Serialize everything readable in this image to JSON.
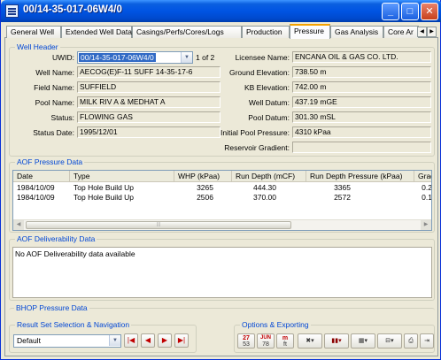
{
  "window": {
    "title": "00/14-35-017-06W4/0"
  },
  "tabs": [
    "General Well",
    "Extended Well Data",
    "Casings/Perfs/Cores/Logs",
    "Production",
    "Pressure",
    "Gas Analysis",
    "Core Ar"
  ],
  "well_header": {
    "legend": "Well Header",
    "uwid_label": "UWID:",
    "uwid_value": "00/14-35-017-06W4/0",
    "uwid_count": "1 of 2",
    "well_name_label": "Well Name:",
    "well_name": "AECOG(E)F-11 SUFF 14-35-17-6",
    "field_name_label": "Field Name:",
    "field_name": "SUFFIELD",
    "pool_name_label": "Pool Name:",
    "pool_name": "MILK RIV A & MEDHAT A",
    "status_label": "Status:",
    "status": "FLOWING GAS",
    "status_date_label": "Status Date:",
    "status_date": "1995/12/01",
    "licensee_label": "Licensee Name:",
    "licensee": "ENCANA OIL & GAS CO. LTD.",
    "ground_elev_label": "Ground Elevation:",
    "ground_elev": "738.50 m",
    "kb_elev_label": "KB Elevation:",
    "kb_elev": "742.00 m",
    "well_datum_label": "Well Datum:",
    "well_datum": "437.19 mGE",
    "pool_datum_label": "Pool Datum:",
    "pool_datum": "301.30 mSL",
    "initial_pressure_label": "Initial Pool Pressure:",
    "initial_pressure": "4310 kPaa",
    "reservoir_gradient_label": "Reservoir Gradient:",
    "reservoir_gradient": ""
  },
  "aof_pressure": {
    "legend": "AOF Pressure Data",
    "columns": [
      "Date",
      "Type",
      "WHP (kPaa)",
      "Run Depth (mCF)",
      "Run Depth Pressure (kPaa)",
      "Grad"
    ],
    "rows": [
      [
        "1984/10/09",
        "Top Hole Build Up",
        "3265",
        "444.30",
        "3365",
        "0.2"
      ],
      [
        "1984/10/09",
        "Top Hole Build Up",
        "2506",
        "370.00",
        "2572",
        "0.1"
      ]
    ]
  },
  "aof_deliverability": {
    "legend": "AOF Deliverability Data",
    "message": "No AOF Deliverability data available"
  },
  "bhop": {
    "legend": "BHOP Pressure Data"
  },
  "result_set": {
    "legend": "Result Set Selection & Navigation",
    "selected": "Default",
    "nav": [
      "first",
      "previous",
      "next",
      "last"
    ]
  },
  "options": {
    "legend": "Options & Exporting",
    "calendar_day": "27",
    "calendar_sub": "53",
    "jun_label": "JUN",
    "jun_day": "78",
    "m_label": "m",
    "m_sub": "ft"
  }
}
